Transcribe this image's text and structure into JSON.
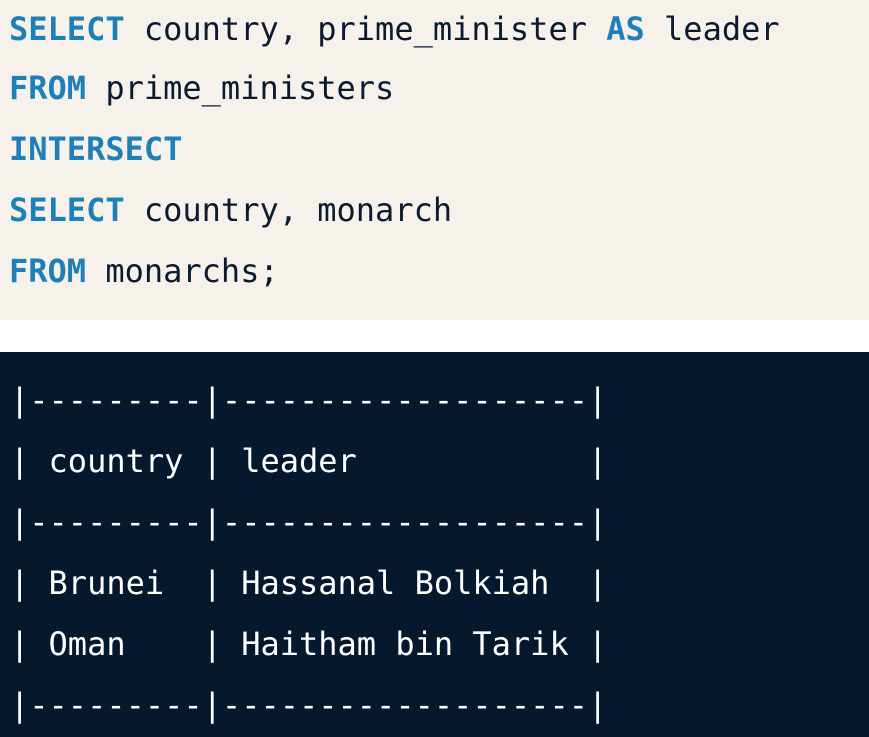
{
  "query": {
    "lines": [
      {
        "keyword": "SELECT",
        "rest": " country, prime_minister ",
        "keyword2": "AS",
        "rest2": " leader"
      },
      {
        "keyword": "FROM",
        "rest": " prime_ministers",
        "keyword2": "",
        "rest2": ""
      },
      {
        "keyword": "INTERSECT",
        "rest": "",
        "keyword2": "",
        "rest2": ""
      },
      {
        "keyword": "SELECT",
        "rest": " country, monarch",
        "keyword2": "",
        "rest2": ""
      },
      {
        "keyword": "FROM",
        "rest": " monarchs;",
        "keyword2": "",
        "rest2": ""
      }
    ]
  },
  "result": {
    "lines": [
      "|---------|-------------------|",
      "| country | leader            |",
      "|---------|-------------------|",
      "| Brunei  | Hassanal Bolkiah  |",
      "| Oman    | Haitham bin Tarik |",
      "|---------|-------------------|"
    ]
  },
  "colors": {
    "keyword": "#1f7fb8",
    "code_background": "#f6f2eb",
    "result_background": "#05182d"
  }
}
